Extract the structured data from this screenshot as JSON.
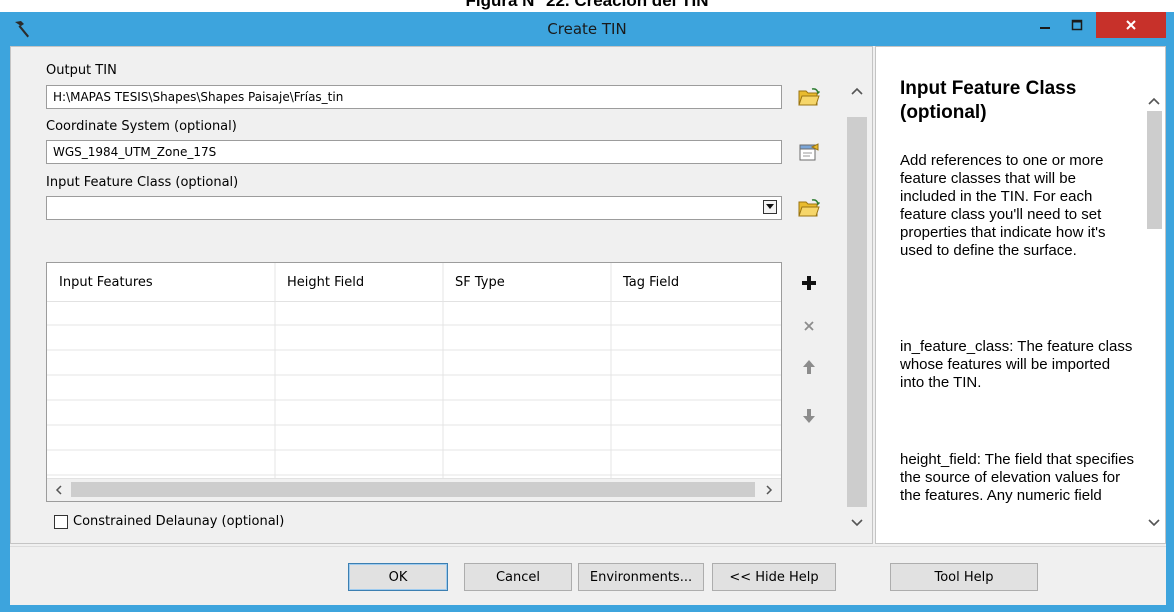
{
  "caption": "Figura N° 22. Creación del TIN",
  "window": {
    "title": "Create TIN"
  },
  "parameters": {
    "output_tin": {
      "label": "Output TIN",
      "value": "H:\\MAPAS TESIS\\Shapes\\Shapes Paisaje\\Frías_tin"
    },
    "coordinate_system": {
      "label": "Coordinate System (optional)",
      "value": "WGS_1984_UTM_Zone_17S"
    },
    "input_feature_class": {
      "label": "Input Feature Class (optional)",
      "value": ""
    },
    "table": {
      "columns": [
        "Input Features",
        "Height Field",
        "SF Type",
        "Tag Field"
      ],
      "rows": []
    },
    "constrained_delaunay": {
      "label": "Constrained Delaunay (optional)",
      "checked": false
    }
  },
  "help": {
    "title": "Input Feature Class (optional)",
    "paragraphs": [
      "Add references to one or more feature classes that will be included in the TIN. For each feature class you'll need to set properties that indicate how it's used to define the surface.",
      "in_feature_class: The feature class whose features will be imported into the TIN.",
      "height_field: The field that specifies the source of elevation values for the features. Any numeric field"
    ]
  },
  "buttons": {
    "ok": "OK",
    "cancel": "Cancel",
    "environments": "Environments...",
    "hide_help": "<< Hide Help",
    "tool_help": "Tool Help"
  },
  "colors": {
    "title_bar": "#3da4dd",
    "close_button": "#c7312a",
    "folder_icon": "#e9bb2e"
  },
  "icons": [
    "hammer-icon",
    "folder-open-icon",
    "spatial-reference-icon",
    "plus-icon",
    "x-icon",
    "arrow-up-icon",
    "arrow-down-icon"
  ]
}
